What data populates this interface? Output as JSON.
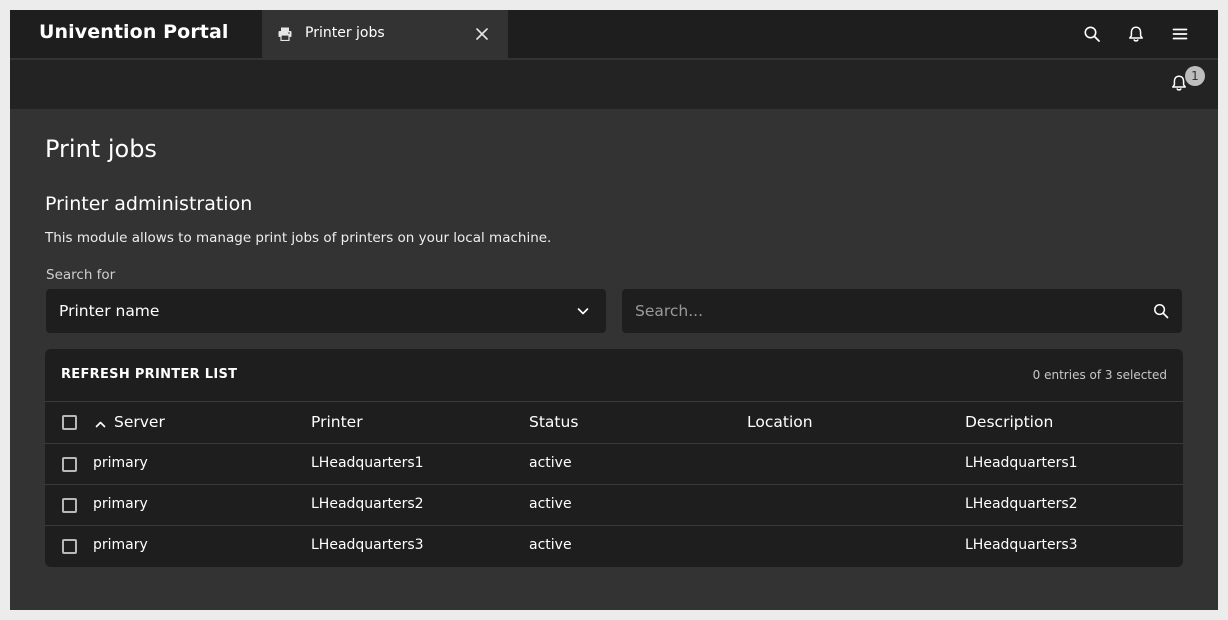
{
  "header": {
    "brand": "Univention Portal",
    "tab": {
      "label": "Printer jobs",
      "icon": "printer-icon"
    },
    "icons": [
      "search-icon",
      "bell-icon",
      "menu-icon"
    ]
  },
  "subbar": {
    "notification_count": "1"
  },
  "page": {
    "title": "Print jobs",
    "section_title": "Printer administration",
    "description": "This module allows to manage print jobs of printers on your local machine."
  },
  "search": {
    "label": "Search for",
    "select_value": "Printer name",
    "placeholder": "Search...",
    "value": ""
  },
  "grid": {
    "refresh_label": "REFRESH PRINTER LIST",
    "selection_status": "0 entries of 3 selected",
    "columns": [
      "Server",
      "Printer",
      "Status",
      "Location",
      "Description"
    ],
    "sorted_column": "Server",
    "rows": [
      {
        "server": "primary",
        "printer": "LHeadquarters1",
        "status": "active",
        "location": "",
        "description": "LHeadquarters1"
      },
      {
        "server": "primary",
        "printer": "LHeadquarters2",
        "status": "active",
        "location": "",
        "description": "LHeadquarters2"
      },
      {
        "server": "primary",
        "printer": "LHeadquarters3",
        "status": "active",
        "location": "",
        "description": "LHeadquarters3"
      }
    ]
  },
  "colors": {
    "topbar": "#1e1e1e",
    "background": "#333333",
    "surface": "#1e1e1e",
    "text": "#ffffff"
  }
}
